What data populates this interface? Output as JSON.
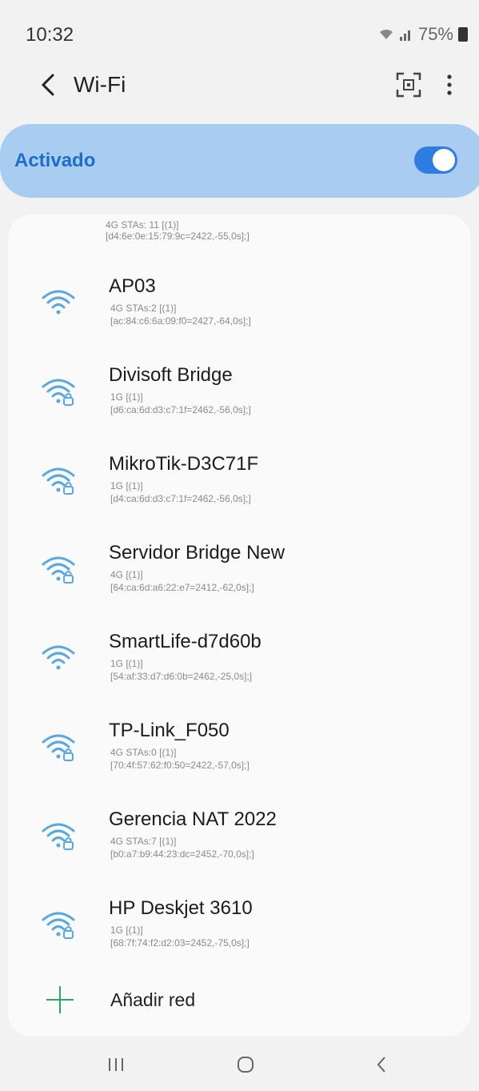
{
  "status": {
    "time": "10:32",
    "battery": "75%"
  },
  "appbar": {
    "title": "Wi-Fi"
  },
  "toggle": {
    "label": "Activado",
    "on": true
  },
  "partial": {
    "line1": "4G STAs: 11 [(1)]",
    "line2": "[d4:6e:0e:15:79:9c=2422,-55,0s];]"
  },
  "networks": [
    {
      "name": "AP03",
      "line1": "4G STAs:2 [(1)]",
      "line2": "[ac:84:c6:6a:09:f0=2427,-64,0s];]",
      "secured": false
    },
    {
      "name": "Divisoft Bridge",
      "line1": "1G [(1)]",
      "line2": "[d6:ca:6d:d3:c7:1f=2462,-56,0s];]",
      "secured": true
    },
    {
      "name": "MikroTik-D3C71F",
      "line1": "1G [(1)]",
      "line2": "[d4:ca:6d:d3:c7:1f=2462,-56,0s];]",
      "secured": true
    },
    {
      "name": "Servidor Bridge New",
      "line1": "4G [(1)]",
      "line2": "[64:ca:6d:a6:22:e7=2412,-62,0s];]",
      "secured": true
    },
    {
      "name": "SmartLife-d7d60b",
      "line1": "1G [(1)]",
      "line2": "[54:af:33:d7:d6:0b=2462,-25,0s];]",
      "secured": false
    },
    {
      "name": "TP-Link_F050",
      "line1": "4G STAs:0 [(1)]",
      "line2": "[70:4f:57:62:f0:50=2422,-57,0s];]",
      "secured": true
    },
    {
      "name": "Gerencia NAT 2022",
      "line1": "4G STAs:7 [(1)]",
      "line2": "[b0:a7:b9:44:23:dc=2452,-70,0s];]",
      "secured": true
    },
    {
      "name": "HP Deskjet 3610",
      "line1": "1G [(1)]",
      "line2": "[68:7f:74:f2:d2:03=2452,-75,0s];]",
      "secured": true
    }
  ],
  "add_network": {
    "label": "Añadir red"
  },
  "colors": {
    "accent": "#2f7de0",
    "card_active": "#a9cdf0",
    "wifi_icon": "#5aa8e0",
    "add_icon": "#2aa66a"
  }
}
